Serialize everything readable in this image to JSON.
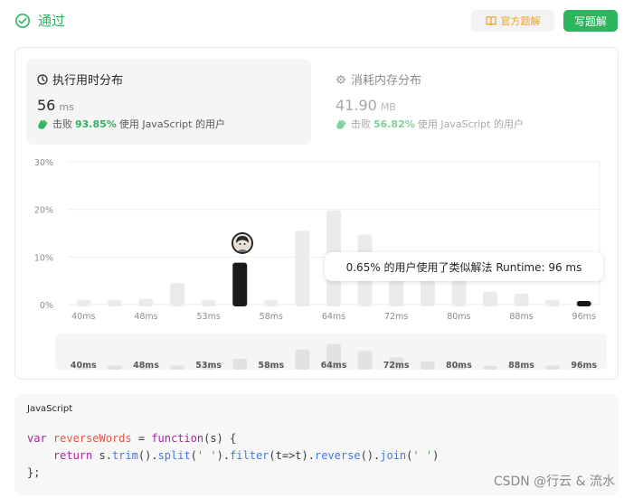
{
  "header": {
    "status": "通过",
    "official_solution": "官方题解",
    "write_solution": "写题解"
  },
  "runtime": {
    "title": "执行用时分布",
    "value": "56",
    "unit": "ms",
    "beat_prefix": "击败",
    "beat_pct": "93.85%",
    "beat_suffix": "使用 JavaScript 的用户"
  },
  "memory": {
    "title": "消耗内存分布",
    "value": "41.90",
    "unit": "MB",
    "beat_prefix": "击败",
    "beat_pct": "56.82%",
    "beat_suffix": "使用 JavaScript 的用户"
  },
  "tooltip": "0.65% 的用户使用了类似解法 Runtime: 96 ms",
  "chart_data": {
    "type": "bar",
    "y_ticks": [
      "30%",
      "20%",
      "10%",
      "0%"
    ],
    "ylim": [
      0,
      30
    ],
    "x_tick_labels": [
      "40ms",
      "48ms",
      "53ms",
      "58ms",
      "64ms",
      "72ms",
      "80ms",
      "88ms",
      "96ms"
    ],
    "values": [
      1.0,
      1.0,
      1.2,
      4.5,
      1.0,
      8.8,
      1.0,
      15.5,
      19.8,
      14.7,
      10.5,
      8.5,
      5.0,
      2.7,
      2.3,
      1.0,
      0.65
    ],
    "highlight_index": 5,
    "hover_index": 16,
    "colors": {
      "bar": "#ebebeb",
      "highlight": "#1a1a1a",
      "grid": "#eeeeee"
    },
    "overview_values": [
      0.5,
      1.0,
      1.0,
      1.0,
      1.2,
      2.6,
      1.0,
      4.8,
      6.2,
      4.5,
      3.0,
      2.0,
      1.0,
      0.9,
      0.8,
      1.0,
      0.5
    ],
    "overview_tick_labels": [
      "40ms",
      "48ms",
      "53ms",
      "58ms",
      "64ms",
      "72ms",
      "80ms",
      "88ms",
      "96ms"
    ]
  },
  "code": {
    "language": "JavaScript",
    "line1": {
      "kw": "var",
      "name": "reverseWords",
      "eq": " = ",
      "fn_kw": "function",
      "params": "(s) {"
    },
    "line2": {
      "kw": "return",
      "expr_a": " s.",
      "trim": "trim",
      "mid1": "().",
      "split": "split",
      "arg1": "' '",
      "mid2": ").",
      "filter": "filter",
      "arrow": "(t=>t).",
      "reverse": "reverse",
      "mid3": "().",
      "join": "join",
      "mid4": "(",
      "arg2": "' '",
      "end": ")"
    },
    "line3": "};"
  },
  "watermark": "CSDN @行云 & 流水"
}
